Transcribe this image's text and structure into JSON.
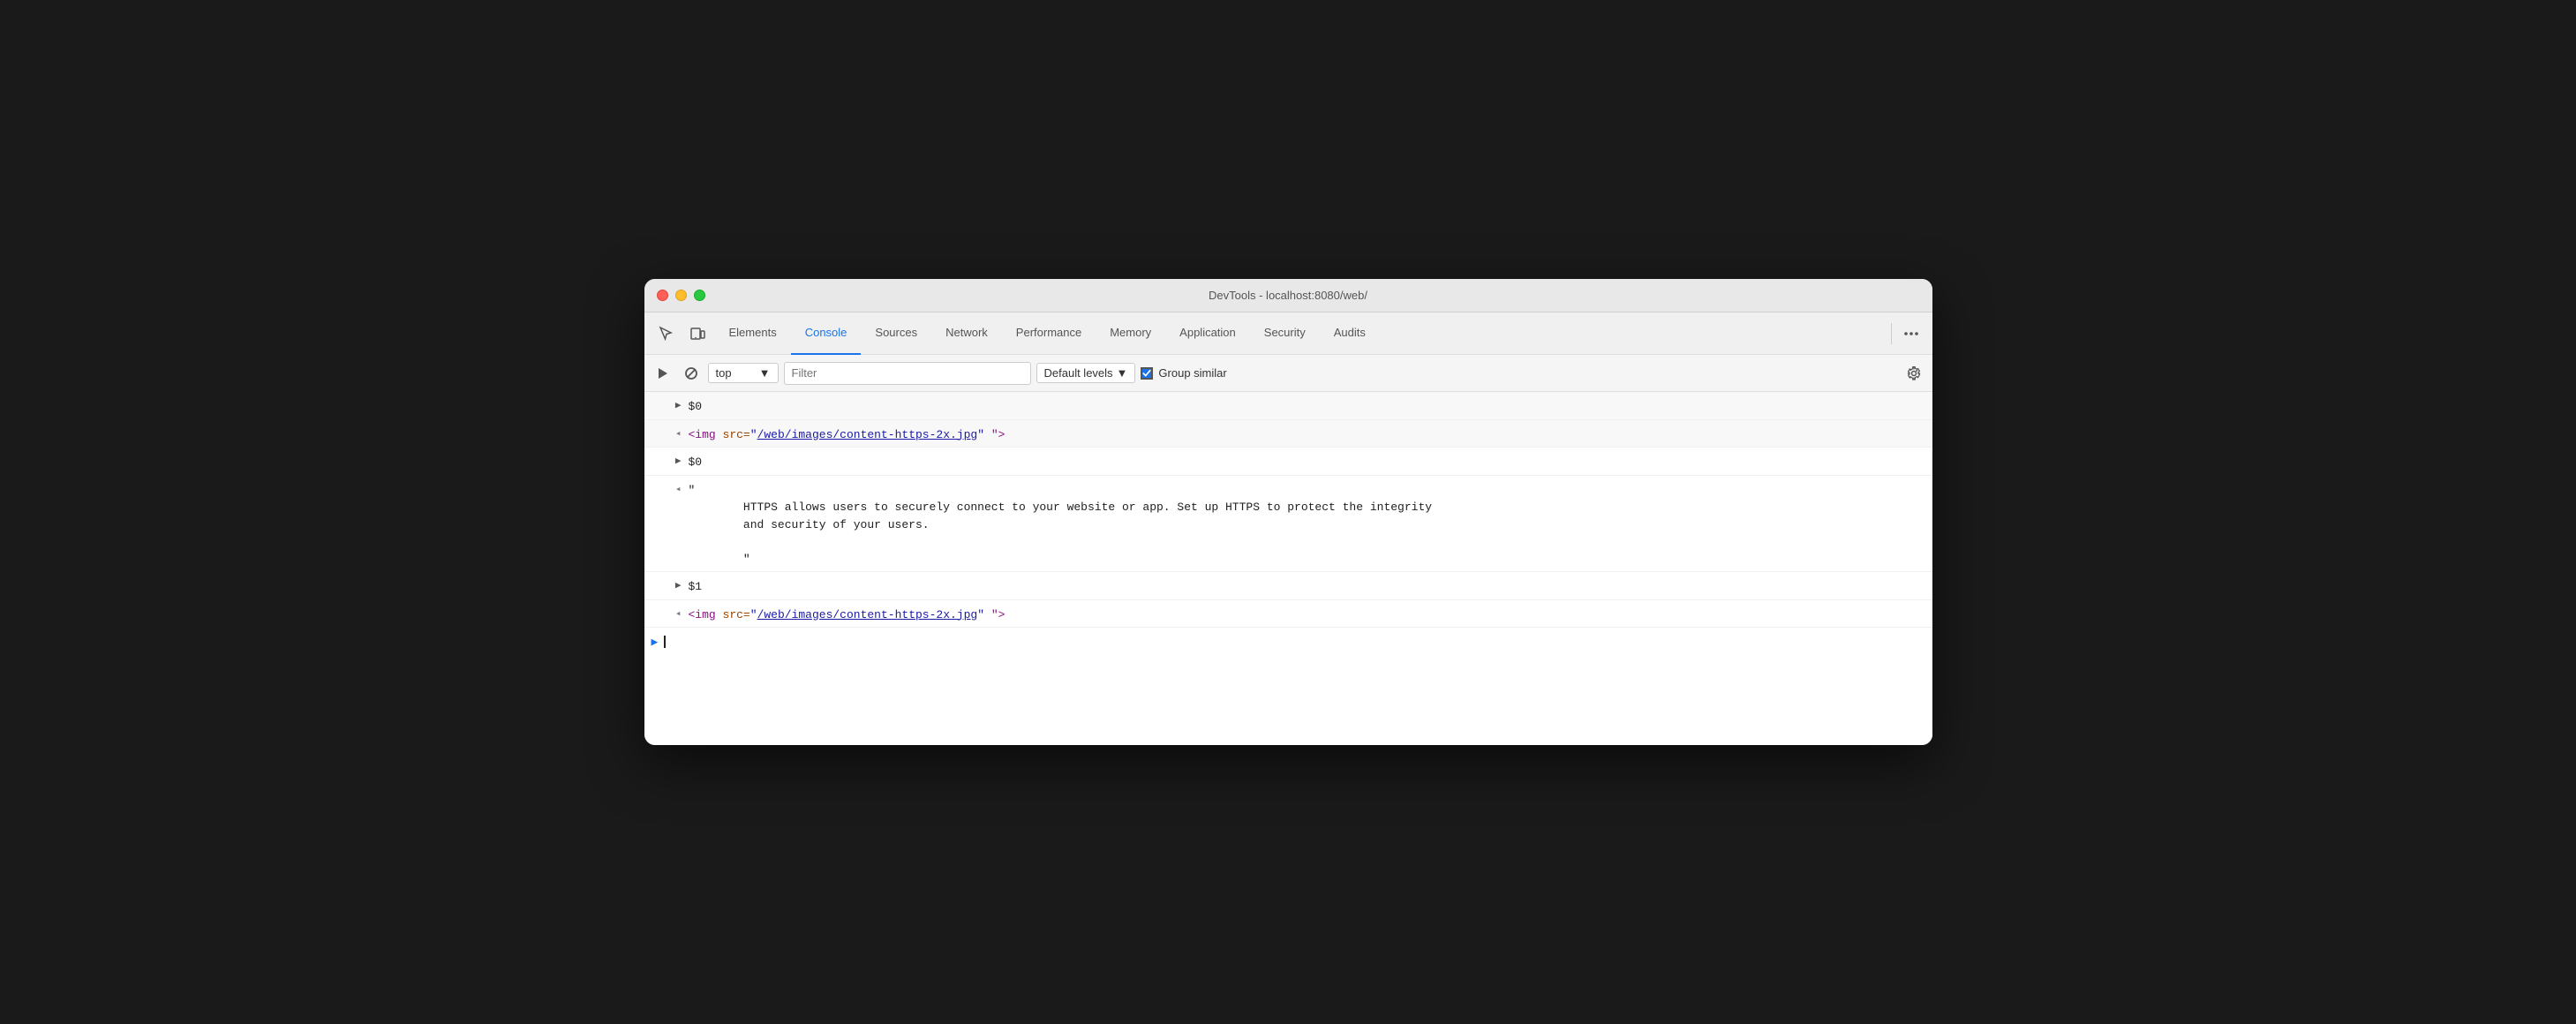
{
  "window": {
    "title": "DevTools - localhost:8080/web/"
  },
  "tabs": {
    "items": [
      {
        "id": "elements",
        "label": "Elements",
        "active": false
      },
      {
        "id": "console",
        "label": "Console",
        "active": true
      },
      {
        "id": "sources",
        "label": "Sources",
        "active": false
      },
      {
        "id": "network",
        "label": "Network",
        "active": false
      },
      {
        "id": "performance",
        "label": "Performance",
        "active": false
      },
      {
        "id": "memory",
        "label": "Memory",
        "active": false
      },
      {
        "id": "application",
        "label": "Application",
        "active": false
      },
      {
        "id": "security",
        "label": "Security",
        "active": false
      },
      {
        "id": "audits",
        "label": "Audits",
        "active": false
      }
    ]
  },
  "console_toolbar": {
    "context": "top",
    "filter_placeholder": "Filter",
    "levels_label": "Default levels",
    "group_similar_label": "Group similar"
  },
  "console_rows": [
    {
      "type": "prompt",
      "content": "$0"
    },
    {
      "type": "result",
      "content_html": "<span class=\"console-tag\">&lt;img</span> <span class=\"console-attr-name\">src=</span><span class=\"console-string\">\"<a class=\"console-attr-value\" href=\"#\">/web/images/content-https-2x.jpg</a>\"</span> <span class=\"console-tag\">\"&gt;</span>"
    },
    {
      "type": "prompt",
      "content": "$0"
    },
    {
      "type": "result_text",
      "lines": [
        "\"",
        "        HTTPS allows users to securely connect to your website or app. Set up HTTPS to protect the integrity",
        "        and security of your users.",
        "",
        "        \""
      ]
    },
    {
      "type": "prompt",
      "content": "$1"
    },
    {
      "type": "result",
      "content_html": "<span class=\"console-tag\">&lt;img</span> <span class=\"console-attr-name\">src=</span><span class=\"console-string\">\"<a class=\"console-attr-value\" href=\"#\">/web/images/content-https-2x.jpg</a>\"</span> <span class=\"console-tag\">\"&gt;</span>"
    },
    {
      "type": "input",
      "content": ""
    }
  ]
}
